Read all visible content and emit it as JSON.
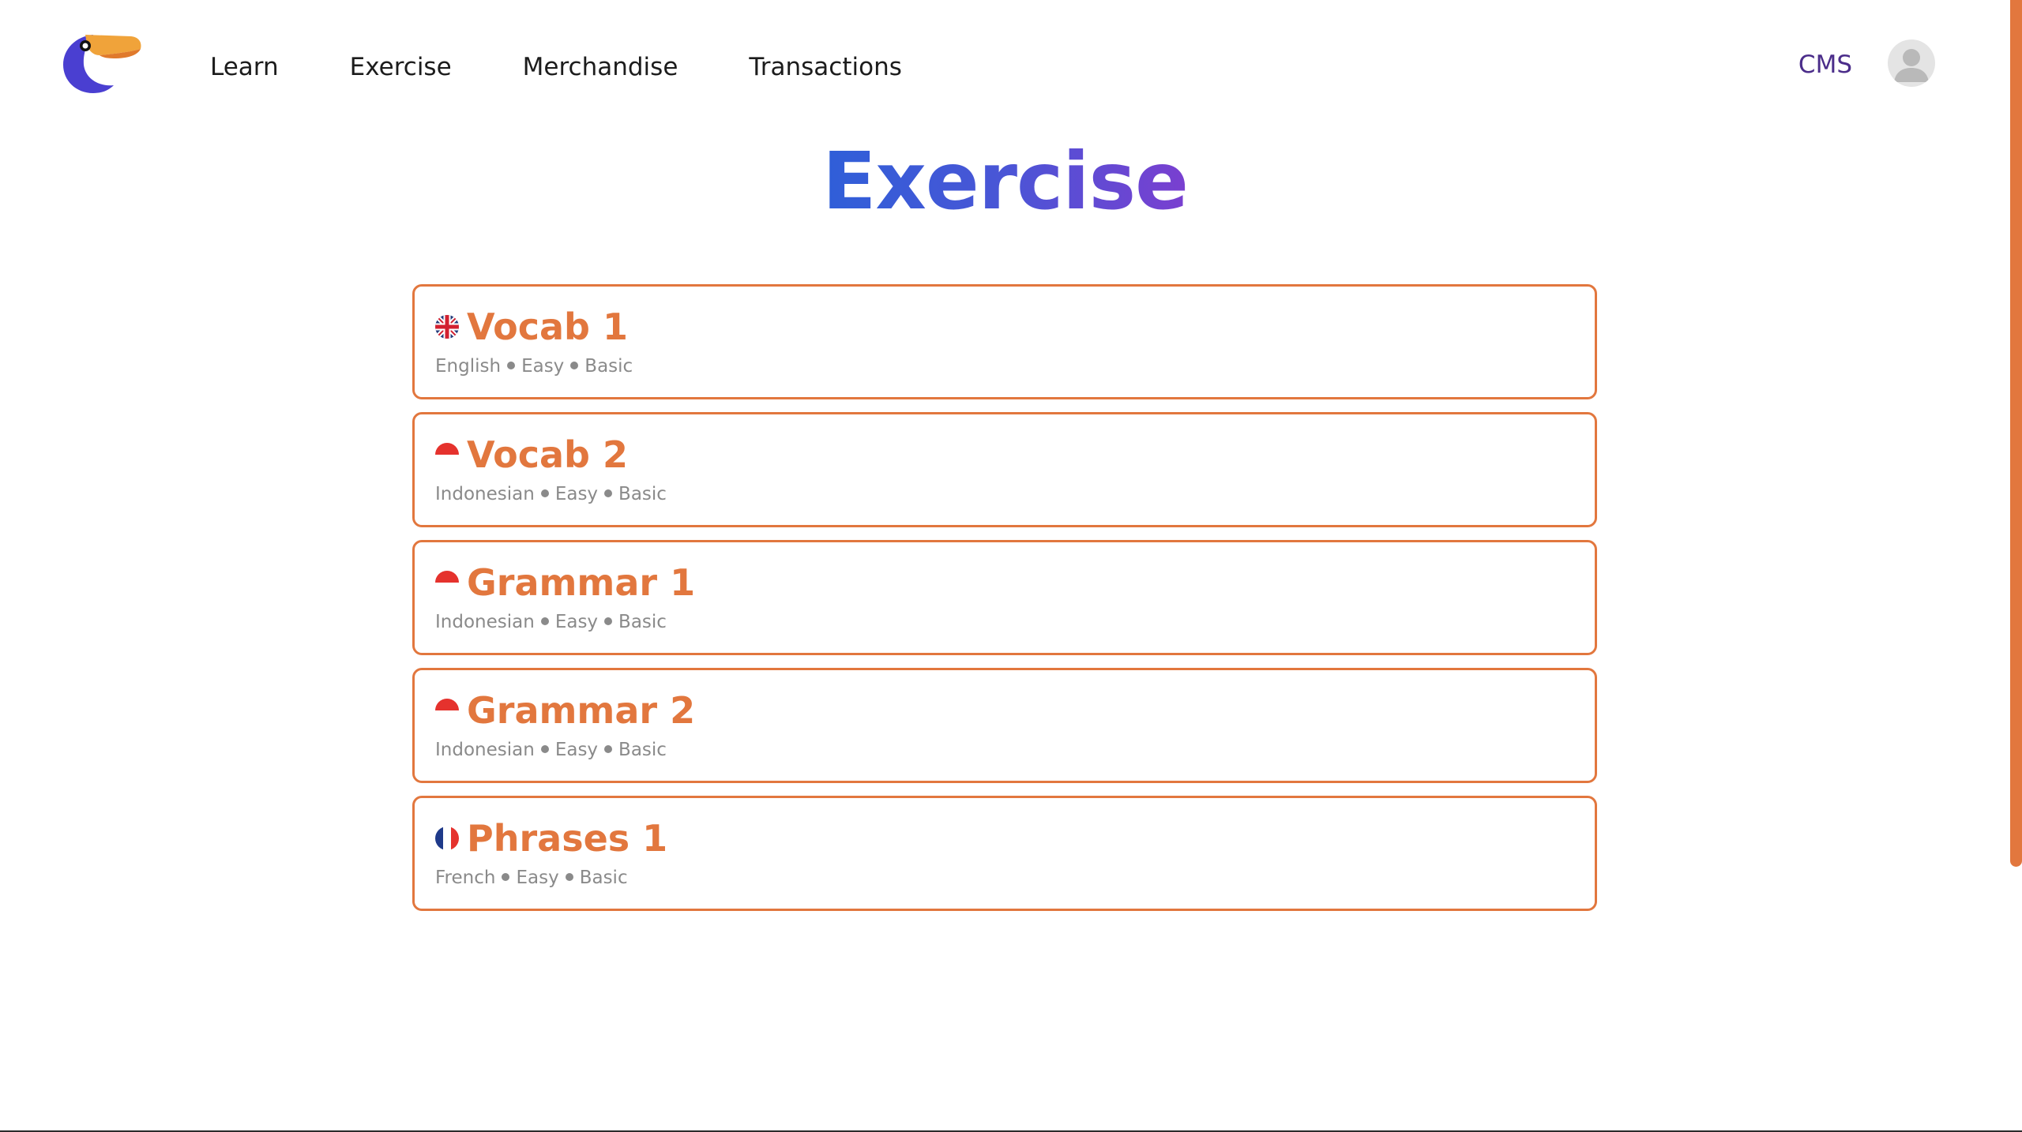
{
  "nav": {
    "items": [
      {
        "label": "Learn"
      },
      {
        "label": "Exercise"
      },
      {
        "label": "Merchandise"
      },
      {
        "label": "Transactions"
      }
    ],
    "cms_label": "CMS"
  },
  "page": {
    "title": "Exercise"
  },
  "exercises": [
    {
      "title": "Vocab 1",
      "flag": "uk-flag-icon",
      "language": "English",
      "difficulty": "Easy",
      "level": "Basic"
    },
    {
      "title": "Vocab 2",
      "flag": "indonesia-flag-icon",
      "language": "Indonesian",
      "difficulty": "Easy",
      "level": "Basic"
    },
    {
      "title": "Grammar 1",
      "flag": "indonesia-flag-icon",
      "language": "Indonesian",
      "difficulty": "Easy",
      "level": "Basic"
    },
    {
      "title": "Grammar 2",
      "flag": "indonesia-flag-icon",
      "language": "Indonesian",
      "difficulty": "Easy",
      "level": "Basic"
    },
    {
      "title": "Phrases 1",
      "flag": "france-flag-icon",
      "language": "French",
      "difficulty": "Easy",
      "level": "Basic"
    }
  ],
  "colors": {
    "accent": "#e2773e",
    "title_gradient_start": "#2f5fd8",
    "title_gradient_end": "#7a3fd0",
    "cms_link": "#4b2d8a",
    "meta_text": "#8a8a8a"
  }
}
